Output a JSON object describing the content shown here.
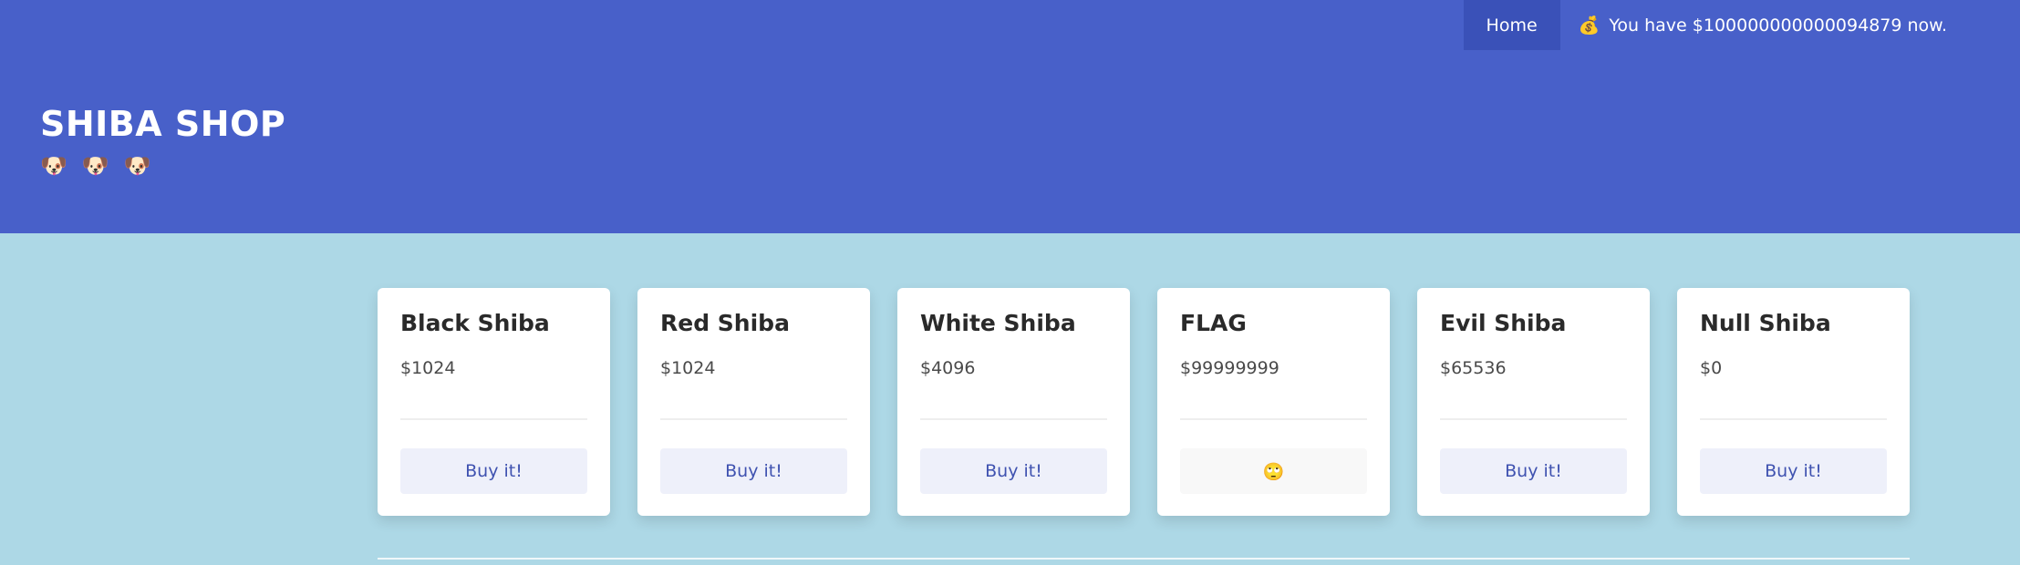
{
  "nav": {
    "home_label": "Home",
    "bag_icon": "💰",
    "balance_text": "You have $100000000000094879 now."
  },
  "brand": {
    "title": "SHIBA SHOP",
    "dog_icon": "🐶"
  },
  "products": [
    {
      "name": "Black Shiba",
      "price": "$1024",
      "button": "Buy it!",
      "disabled": false
    },
    {
      "name": "Red Shiba",
      "price": "$1024",
      "button": "Buy it!",
      "disabled": false
    },
    {
      "name": "White Shiba",
      "price": "$4096",
      "button": "Buy it!",
      "disabled": false
    },
    {
      "name": "FLAG",
      "price": "$99999999",
      "button": "🙄",
      "disabled": true
    },
    {
      "name": "Evil Shiba",
      "price": "$65536",
      "button": "Buy it!",
      "disabled": false
    },
    {
      "name": "Null Shiba",
      "price": "$0",
      "button": "Buy it!",
      "disabled": false
    }
  ],
  "colors": {
    "hero": "#4860c9",
    "page_bg": "#add8e6",
    "button_text": "#3f52b0"
  }
}
